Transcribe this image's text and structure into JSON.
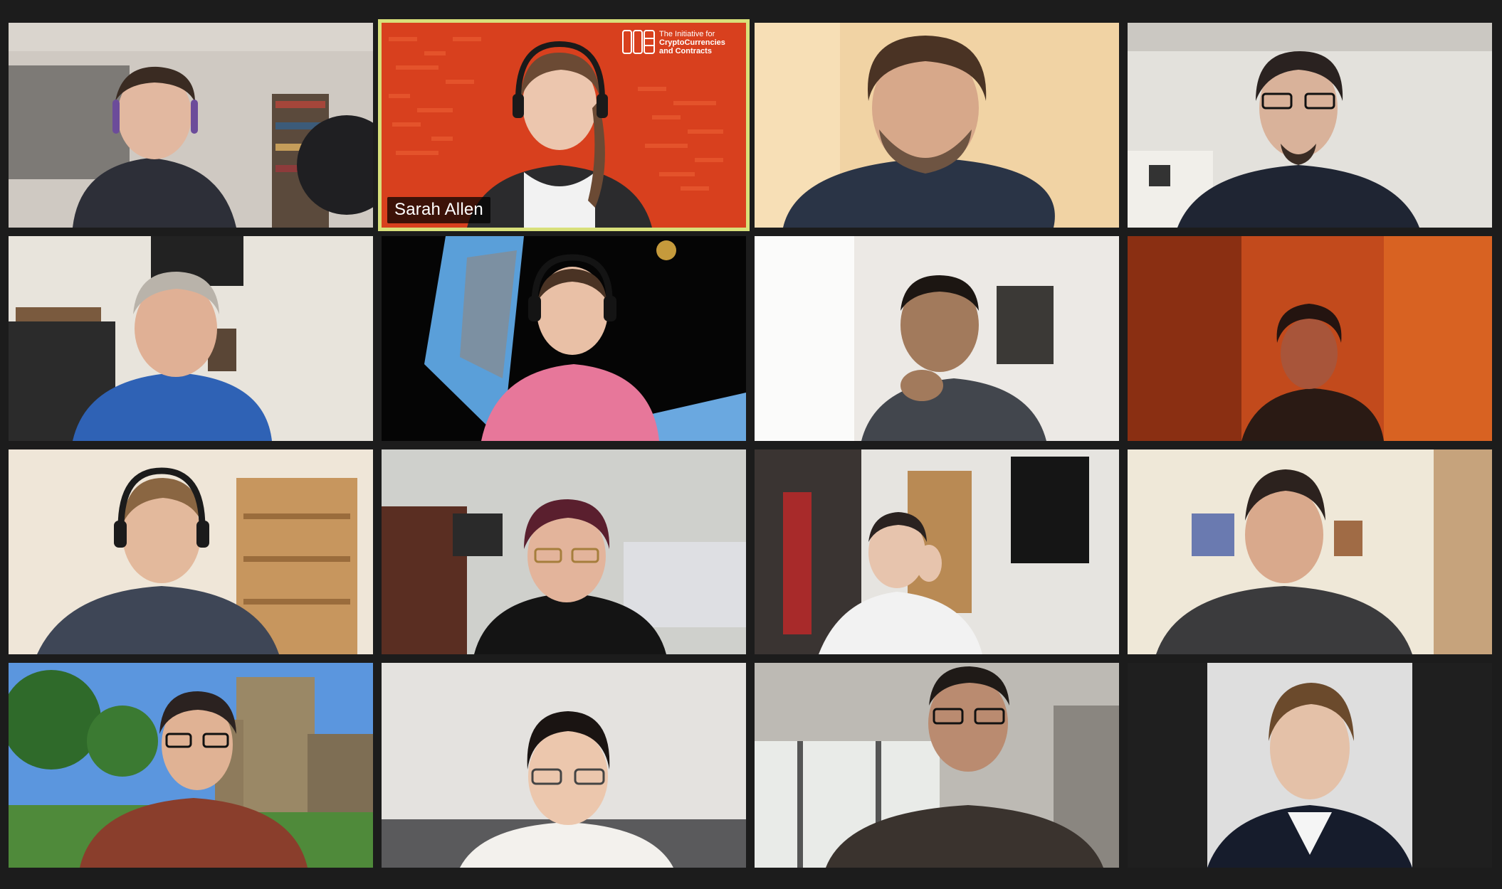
{
  "meeting": {
    "view": "gallery",
    "participant_count": 16,
    "active_speaker_label": "Sarah Allen"
  },
  "logo": {
    "line1": "The Initiative for",
    "line2": "CryptoCurrencies",
    "line3": "and Contracts"
  },
  "colors": {
    "active_speaker_border": "#d8e07a",
    "window_background": "#1c1c1c",
    "name_label_bg": "rgba(0,0,0,0.72)",
    "logo_background": "#d8401e"
  }
}
